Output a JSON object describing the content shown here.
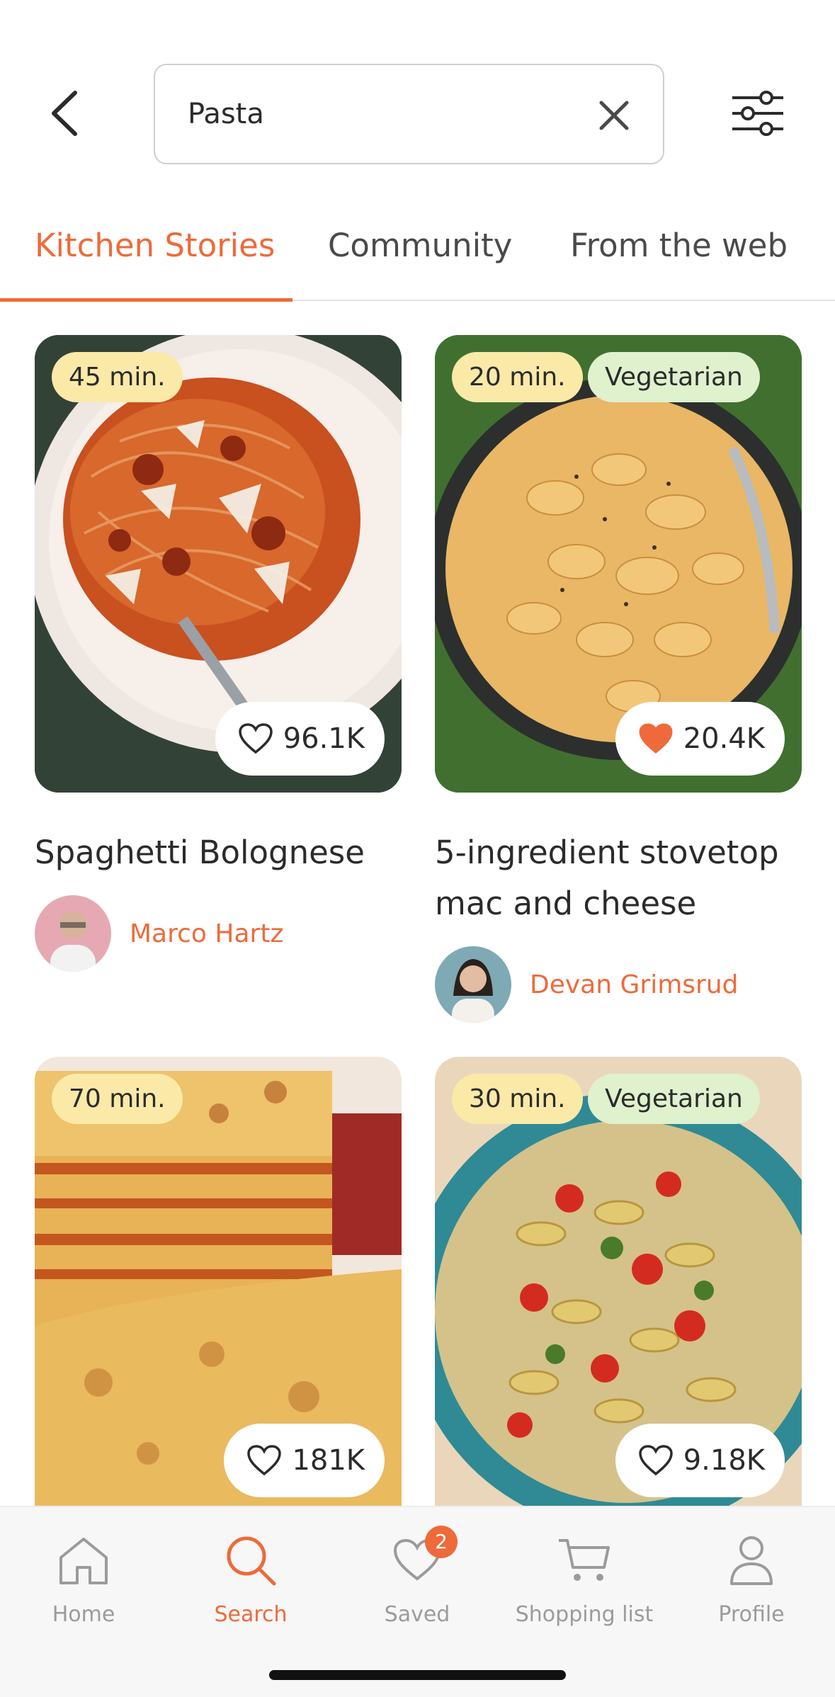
{
  "search": {
    "query": "Pasta"
  },
  "tabs": [
    {
      "label": "Kitchen Stories",
      "active": true
    },
    {
      "label": "Community",
      "active": false
    },
    {
      "label": "From the web",
      "active": false
    }
  ],
  "cards": [
    {
      "time": "45 min.",
      "tag": "",
      "likes": "96.1K",
      "liked": false,
      "title": "Spaghetti Bolognese",
      "author": "Marco Hartz"
    },
    {
      "time": "20 min.",
      "tag": "Vegetarian",
      "likes": "20.4K",
      "liked": true,
      "title": "5-ingredient stovetop mac and cheese",
      "author": "Devan Grimsrud"
    },
    {
      "time": "70 min.",
      "tag": "",
      "likes": "181K",
      "liked": false,
      "title": "",
      "author": ""
    },
    {
      "time": "30 min.",
      "tag": "Vegetarian",
      "likes": "9.18K",
      "liked": false,
      "title": "",
      "author": ""
    }
  ],
  "nav": [
    {
      "label": "Home",
      "icon": "home-icon"
    },
    {
      "label": "Search",
      "icon": "search-icon",
      "active": true
    },
    {
      "label": "Saved",
      "icon": "heart-icon",
      "badge": "2"
    },
    {
      "label": "Shopping list",
      "icon": "cart-icon"
    },
    {
      "label": "Profile",
      "icon": "person-icon"
    }
  ],
  "colors": {
    "accent": "#ee6a3a",
    "time_chip": "#fbe9a8",
    "veg_chip": "#dff1cd"
  }
}
